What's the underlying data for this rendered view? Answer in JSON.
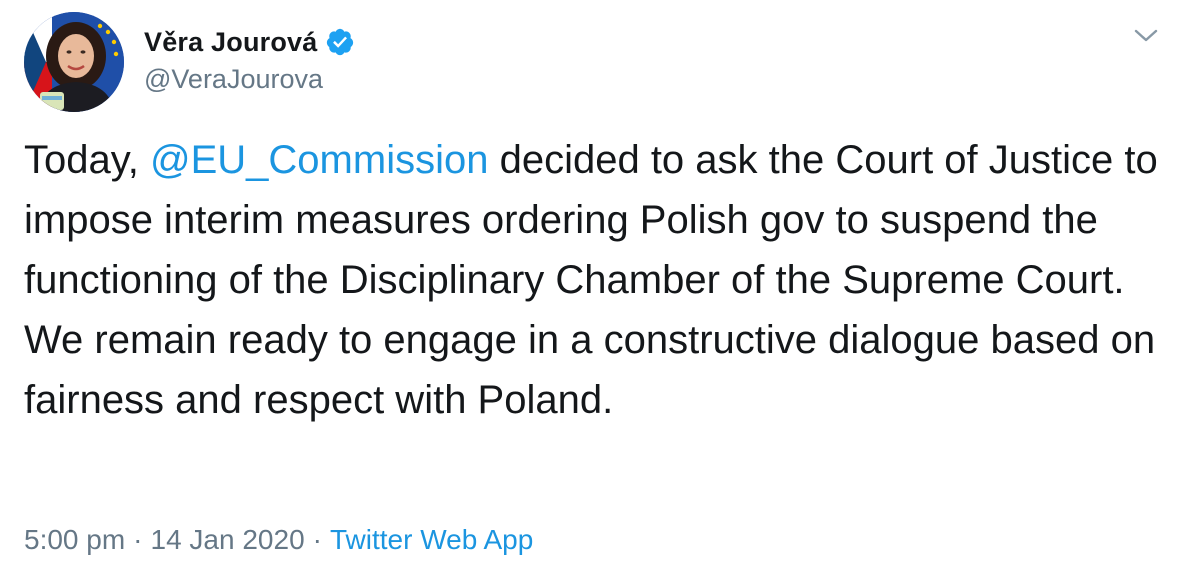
{
  "author": {
    "display_name": "Věra Jourová",
    "handle": "@VeraJourova",
    "verified_icon": "verified-badge-icon",
    "avatar_icon": "profile-photo"
  },
  "tweet": {
    "text_before": "Today, ",
    "mention": "@EU_Commission",
    "text_after": " decided to ask the Court of Justice to impose interim measures ordering Polish gov to suspend the functioning of the Disciplinary Chamber of the Supreme Court. We remain ready to engage in a constructive dialogue based on fairness and respect with Poland."
  },
  "meta": {
    "time": "5:00 pm",
    "separator": "·",
    "date": "14 Jan 2020",
    "source": "Twitter Web App"
  },
  "colors": {
    "link": "#1b95e0",
    "secondary": "#657786",
    "text": "#14171a",
    "verified": "#1da1f2"
  },
  "menu": {
    "icon": "chevron-down-icon"
  }
}
